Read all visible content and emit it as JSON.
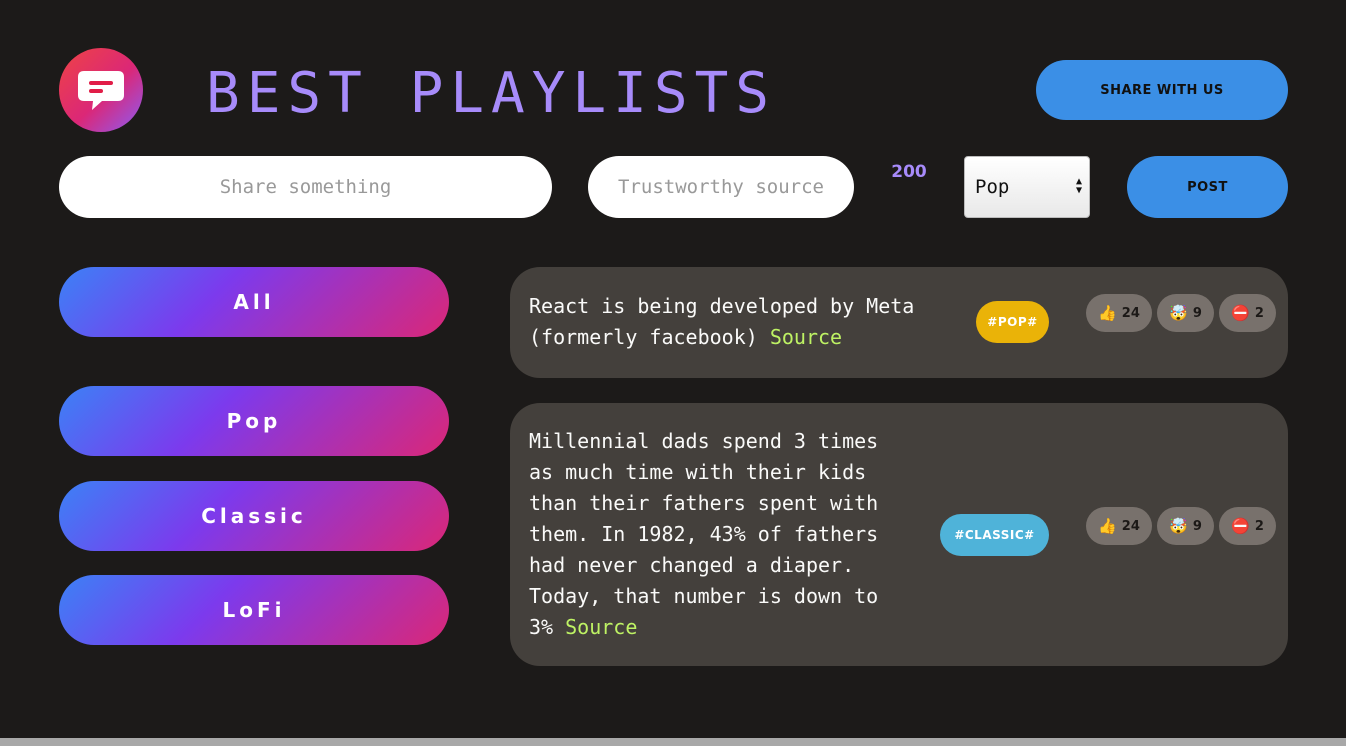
{
  "header": {
    "title": "BEST PLAYLISTS",
    "share_label": "Share with us"
  },
  "form": {
    "text_placeholder": "Share something",
    "source_placeholder": "Trustworthy source",
    "char_count": "200",
    "category_selected": "Pop",
    "post_label": "Post"
  },
  "categories": [
    {
      "label": "All"
    },
    {
      "label": "Pop"
    },
    {
      "label": "Classic"
    },
    {
      "label": "LoFi"
    }
  ],
  "facts": [
    {
      "text": "React is being developed by Meta (formerly facebook)",
      "source_label": "Source",
      "tag": "#POP#",
      "tag_color": "#eab308",
      "votes": {
        "interesting": "24",
        "mindblowing": "9",
        "false": "2"
      }
    },
    {
      "text": "Millennial dads spend 3 times as much time with their kids than their fathers spent with them. In 1982, 43% of fathers had never changed a diaper. Today, that number is down to 3%",
      "source_label": "Source",
      "tag": "#CLASSIC#",
      "tag_color": "#4fb3d9",
      "votes": {
        "interesting": "24",
        "mindblowing": "9",
        "false": "2"
      }
    }
  ],
  "icons": {
    "logo": "chat-bubble-icon",
    "vote_interesting": "👍",
    "vote_mindblowing": "🤯",
    "vote_false": "⛔️"
  },
  "colors": {
    "background": "#1c1a19",
    "accent_purple": "#a78bfa",
    "button_blue": "#3b8fe6",
    "card": "#44403c",
    "link": "#bef264"
  }
}
